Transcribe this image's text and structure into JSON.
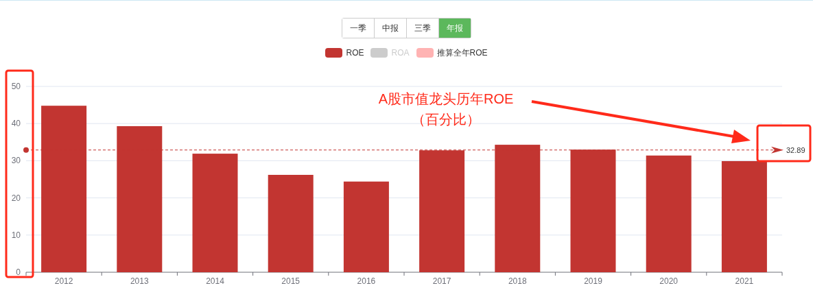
{
  "period_tabs": [
    {
      "label": "一季",
      "selected": false
    },
    {
      "label": "中报",
      "selected": false
    },
    {
      "label": "三季",
      "selected": false
    },
    {
      "label": "年报",
      "selected": true
    }
  ],
  "legend": [
    {
      "enabled": true
    },
    {
      "label": "ROA",
      "enabled": false
    },
    {
      "label": "推算全年ROE",
      "color": "#ffb3b3",
      "enabled": true
    }
  ],
  "chart": {
    "chart_data": {
      "type": "bar",
      "categories": [
        "2012",
        "2013",
        "2014",
        "2015",
        "2016",
        "2017",
        "2018",
        "2019",
        "2020",
        "2021"
      ],
      "series": [
        {
          "name": "ROE",
          "color": "#c23531",
          "values": [
            44.8,
            39.3,
            31.9,
            26.2,
            24.4,
            32.8,
            34.3,
            33.0,
            31.4,
            29.9
          ]
        }
      ],
      "ylim": [
        0,
        50
      ],
      "yticks": [
        0,
        10,
        20,
        30,
        40,
        50
      ],
      "grid": true,
      "ref_lines": [
        {
          "axis": "y",
          "value": 32.89,
          "label": "32.89",
          "color": "#c23531"
        }
      ]
    }
  },
  "note": {
    "lines": [
      "A股市值龙头历年ROE",
      "（百分比）"
    ]
  }
}
